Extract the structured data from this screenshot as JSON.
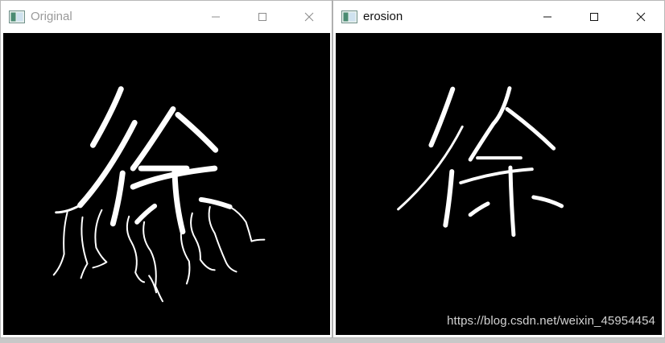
{
  "windows": {
    "original": {
      "title": "Original",
      "active": false,
      "icon": "opencv-window-icon",
      "controls": [
        "minimize-icon",
        "maximize-icon",
        "close-icon"
      ]
    },
    "erosion": {
      "title": "erosion",
      "active": true,
      "icon": "opencv-window-icon",
      "controls": [
        "minimize-icon",
        "maximize-icon",
        "close-icon"
      ]
    }
  },
  "watermark": {
    "text": "https://blog.csdn.net/weixin_45954454"
  },
  "colors": {
    "titlebar": "#ffffff",
    "canvas": "#000000",
    "stroke": "#ffffff",
    "inactive_title": "#9a9a9a",
    "active_title": "#111111"
  }
}
